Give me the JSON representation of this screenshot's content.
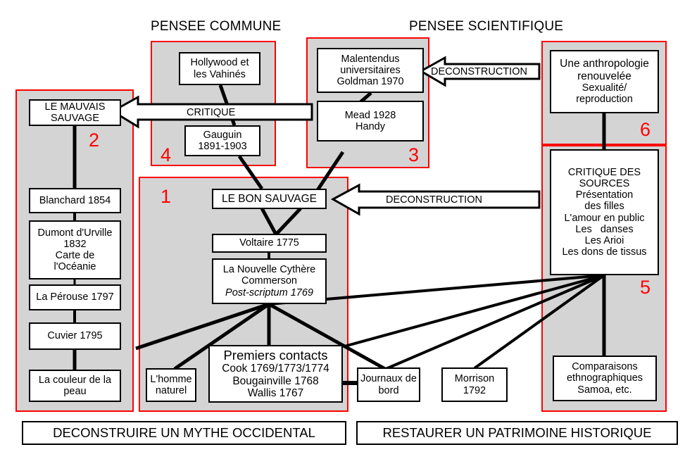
{
  "headers": {
    "left": "PENSEE COMMUNE",
    "right": "PENSEE SCIENTIFIQUE"
  },
  "panels": [
    {
      "id": 1,
      "number": "1"
    },
    {
      "id": 2,
      "number": "2"
    },
    {
      "id": 3,
      "number": "3"
    },
    {
      "id": 4,
      "number": "4"
    },
    {
      "id": 5,
      "number": "5"
    },
    {
      "id": 6,
      "number": "6"
    }
  ],
  "nodes": {
    "mauvais_sauvage": {
      "l1": "LE MAUVAIS",
      "l2": "SAUVAGE"
    },
    "blanchard": {
      "l1": "Blanchard 1854"
    },
    "dumont": {
      "l1": "Dumont d'Urville",
      "l2": "1832",
      "l3": "Carte de",
      "l4": "l'Océanie"
    },
    "laperouse": {
      "l1": "La Pérouse 1797"
    },
    "cuvier": {
      "l1": "Cuvier 1795"
    },
    "couleur": {
      "l1": "La couleur de la",
      "l2": "peau"
    },
    "hollywood": {
      "l1": "Hollywood et",
      "l2": "les Vahinés"
    },
    "gauguin": {
      "l1": "Gauguin",
      "l2": "1891-1903"
    },
    "malentendus": {
      "l1": "Malentendus",
      "l2": "universitaires",
      "l3": "Goldman 1970"
    },
    "mead": {
      "l1": "Mead 1928",
      "l2": "Handy"
    },
    "bon_sauvage": {
      "l1": "LE BON SAUVAGE"
    },
    "voltaire": {
      "l1": "Voltaire 1775"
    },
    "cythere": {
      "l1": "La Nouvelle Cythère",
      "l2": "Commerson",
      "l3": "Post-scriptum 1769"
    },
    "premiers": {
      "l1": "Premiers contacts",
      "l2": "Cook 1769/1773/1774",
      "l3": "Bougainville 1768",
      "l4": "Wallis 1767"
    },
    "homme_naturel": {
      "l1": "L'homme",
      "l2": "naturel"
    },
    "journaux": {
      "l1": "Journaux de",
      "l2": "bord"
    },
    "morrison": {
      "l1": "Morrison",
      "l2": "1792"
    },
    "anthropologie": {
      "l1": "Une anthropologie",
      "l2": "renouvelée",
      "l3": "Sexualité/",
      "l4": "reproduction"
    },
    "critique_sources": {
      "l1": "CRITIQUE DES",
      "l2": "SOURCES",
      "l3": "Présentation",
      "l4": "des filles",
      "l5": "L'amour en public",
      "l6": "Les   danses",
      "l7": "Les Arioi",
      "l8": "Les dons de tissus"
    },
    "comparaisons": {
      "l1": "Comparaisons",
      "l2": "ethnographiques",
      "l3": "Samoa, etc."
    }
  },
  "arrows": {
    "critique": "CRITIQUE",
    "deconstruction_top": "DECONSTRUCTION",
    "deconstruction_mid": "DECONSTRUCTION"
  },
  "banners": {
    "left": "DECONSTRUIRE UN MYTHE OCCIDENTAL",
    "right": "RESTAURER UN PATRIMOINE HISTORIQUE"
  },
  "colors": {
    "panel_border": "#ff0000",
    "panel_fill": "#d4d4d4",
    "node_border": "#000000",
    "number": "#ff0000"
  }
}
